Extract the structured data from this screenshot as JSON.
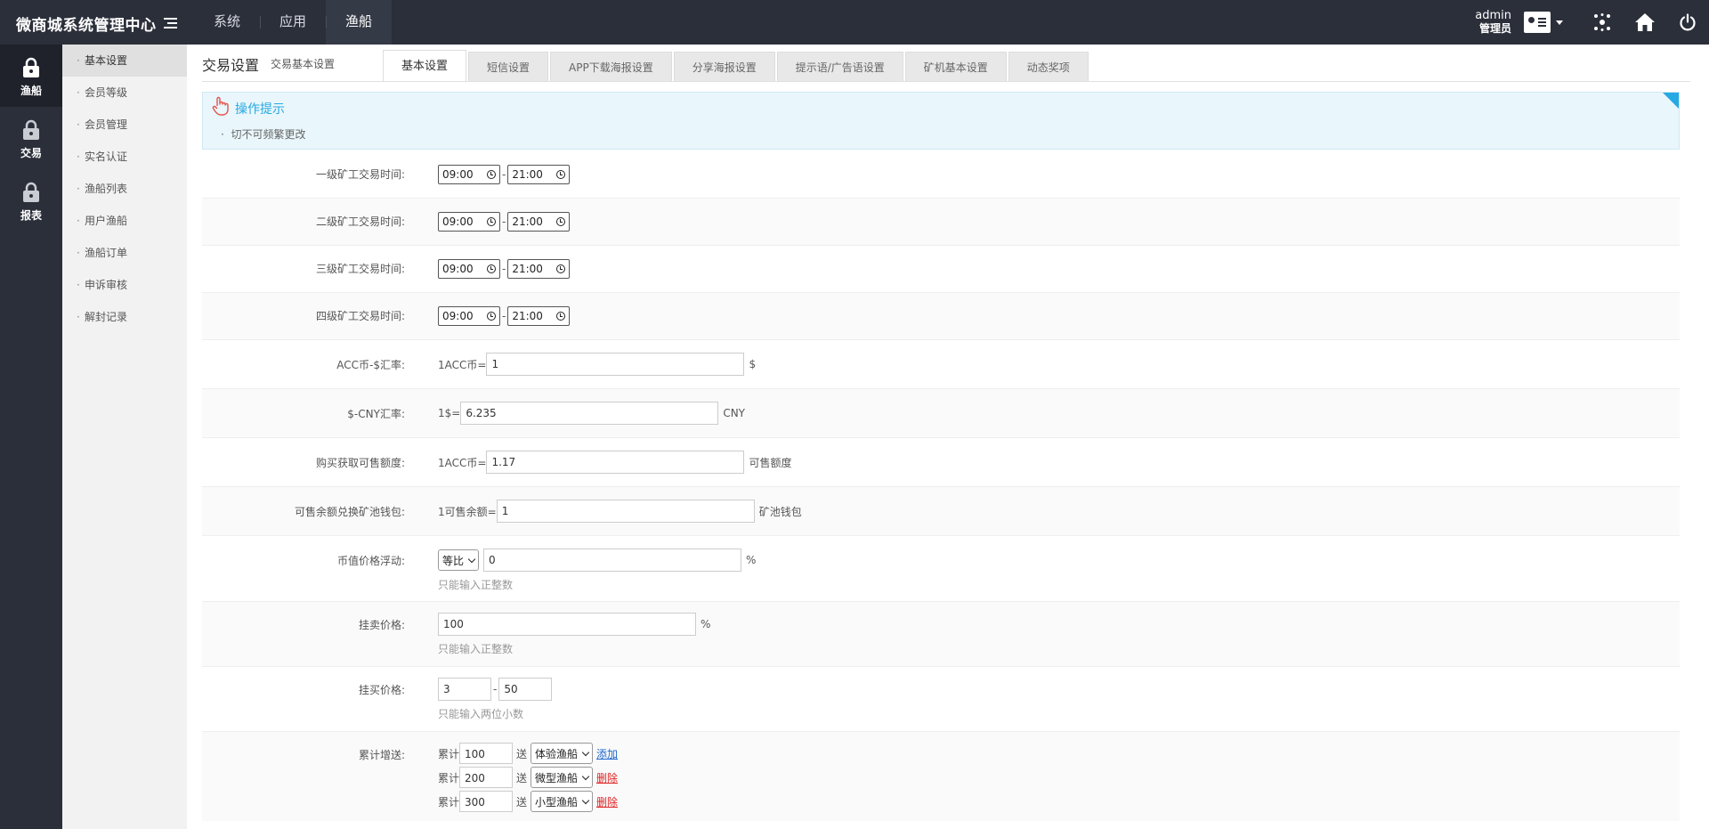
{
  "app": {
    "title": "微商城系统管理中心"
  },
  "topnav": {
    "items": [
      "系统",
      "应用",
      "渔船"
    ]
  },
  "user": {
    "name": "admin",
    "role": "管理员"
  },
  "iconbar": {
    "items": [
      "渔船",
      "交易",
      "报表"
    ]
  },
  "submenu": {
    "items": [
      "基本设置",
      "会员等级",
      "会员管理",
      "实名认证",
      "渔船列表",
      "用户渔船",
      "渔船订单",
      "申诉审核",
      "解封记录"
    ]
  },
  "page": {
    "title": "交易设置",
    "subtitle": "交易基本设置"
  },
  "tabs": [
    "基本设置",
    "短信设置",
    "APP下载海报设置",
    "分享海报设置",
    "提示语/广告语设置",
    "矿机基本设置",
    "动态奖项"
  ],
  "tips": {
    "title": "操作提示",
    "line": "切不可频繁更改"
  },
  "form": {
    "level1": {
      "label": "一级矿工交易时间:",
      "start": "09:00",
      "end": "21:00"
    },
    "level2": {
      "label": "二级矿工交易时间:",
      "start": "09:00",
      "end": "21:00"
    },
    "level3": {
      "label": "三级矿工交易时间:",
      "start": "09:00",
      "end": "21:00"
    },
    "level4": {
      "label": "四级矿工交易时间:",
      "start": "09:00",
      "end": "21:00"
    },
    "acc_rate": {
      "label": "ACC币-$汇率:",
      "prefix": "1ACC币=",
      "value": "1",
      "suffix": "$"
    },
    "cny_rate": {
      "label": "$-CNY汇率:",
      "prefix": "1$=",
      "value": "6.235",
      "suffix": "CNY"
    },
    "sell_quota": {
      "label": "购买获取可售额度:",
      "prefix": "1ACC币=",
      "value": "1.17",
      "suffix": "可售额度"
    },
    "pool_wallet": {
      "label": "可售余额兑换矿池钱包:",
      "prefix": "1可售余额=",
      "value": "1",
      "suffix": "矿池钱包"
    },
    "price_float": {
      "label": "币值价格浮动:",
      "mode": "等比",
      "value": "0",
      "suffix": "%",
      "hint": "只能输入正整数"
    },
    "sell_price": {
      "label": "挂卖价格:",
      "value": "100",
      "suffix": "%",
      "hint": "只能输入正整数"
    },
    "buy_price": {
      "label": "挂买价格:",
      "min": "3",
      "max": "50",
      "hint": "只能输入两位小数"
    },
    "bonus": {
      "label": "累计增送:",
      "prefix": "累计",
      "mid": "送",
      "rows": [
        {
          "amount": "100",
          "boat": "体验渔船",
          "action": "添加"
        },
        {
          "amount": "200",
          "boat": "微型渔船",
          "action": "删除"
        },
        {
          "amount": "300",
          "boat": "小型渔船",
          "action": "删除"
        }
      ]
    }
  }
}
